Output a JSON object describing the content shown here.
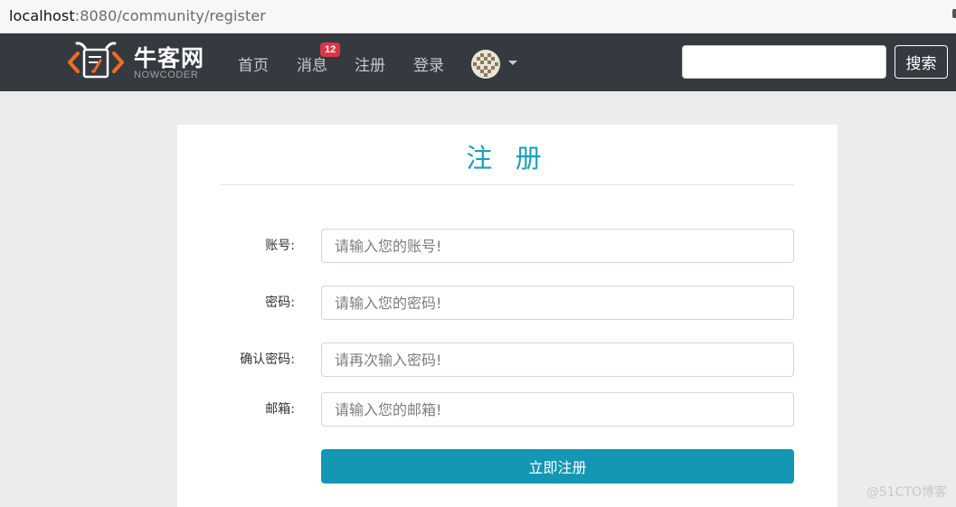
{
  "browser": {
    "url_host": "localhost",
    "url_rest": ":8080/community/register"
  },
  "navbar": {
    "logo_cn": "牛客网",
    "logo_en": "NOWCODER",
    "links": {
      "home": "首页",
      "messages": "消息",
      "register": "注册",
      "login": "登录"
    },
    "message_badge": "12",
    "avatar_icon": "user-avatar-icon",
    "search_button": "搜索",
    "search_value": ""
  },
  "form": {
    "title": "注 册",
    "fields": [
      {
        "label": "账号:",
        "placeholder": "请输入您的账号!"
      },
      {
        "label": "密码:",
        "placeholder": "请输入您的密码!"
      },
      {
        "label": "确认密码:",
        "placeholder": "请再次输入密码!"
      },
      {
        "label": "邮箱:",
        "placeholder": "请输入您的邮箱!"
      }
    ],
    "submit_label": "立即注册"
  },
  "watermark": "@51CTO博客",
  "colors": {
    "navbar_bg": "#343a40",
    "accent": "#17a2b8",
    "primary_button": "#1496b5",
    "badge": "#dc3545"
  }
}
